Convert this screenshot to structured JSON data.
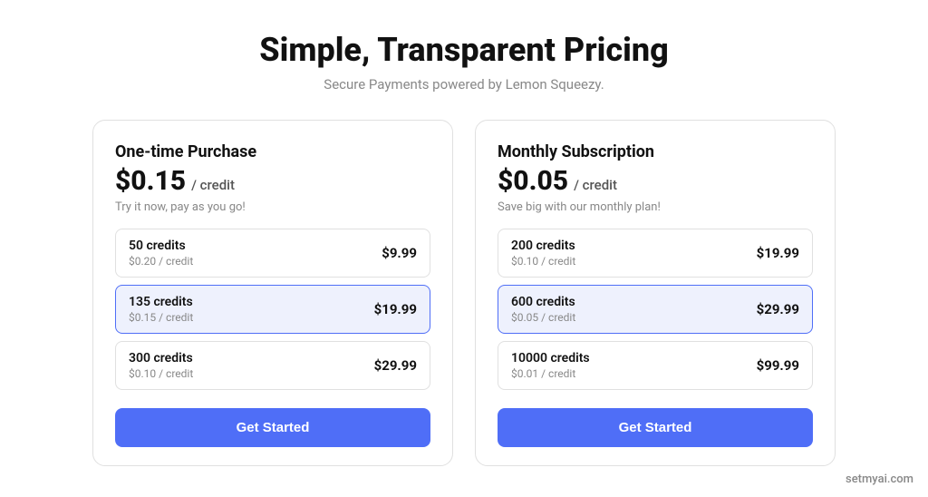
{
  "header": {
    "title": "Simple, Transparent Pricing",
    "subtitle": "Secure Payments powered by Lemon Squeezy."
  },
  "cards": [
    {
      "id": "one-time",
      "title": "One-time Purchase",
      "price": "$0.15",
      "price_unit": "/ credit",
      "subtitle": "Try it now, pay as you go!",
      "options": [
        {
          "credits": "50 credits",
          "per_credit": "$0.20 / credit",
          "price": "$9.99",
          "selected": false
        },
        {
          "credits": "135 credits",
          "per_credit": "$0.15 / credit",
          "price": "$19.99",
          "selected": true
        },
        {
          "credits": "300 credits",
          "per_credit": "$0.10 / credit",
          "price": "$29.99",
          "selected": false
        }
      ],
      "button_label": "Get Started"
    },
    {
      "id": "monthly",
      "title": "Monthly Subscription",
      "price": "$0.05",
      "price_unit": "/ credit",
      "subtitle": "Save big with our monthly plan!",
      "options": [
        {
          "credits": "200 credits",
          "per_credit": "$0.10 / credit",
          "price": "$19.99",
          "selected": false
        },
        {
          "credits": "600 credits",
          "per_credit": "$0.05 / credit",
          "price": "$29.99",
          "selected": true
        },
        {
          "credits": "10000 credits",
          "per_credit": "$0.01 / credit",
          "price": "$99.99",
          "selected": false
        }
      ],
      "button_label": "Get Started"
    }
  ],
  "watermark": "setmyai.com"
}
